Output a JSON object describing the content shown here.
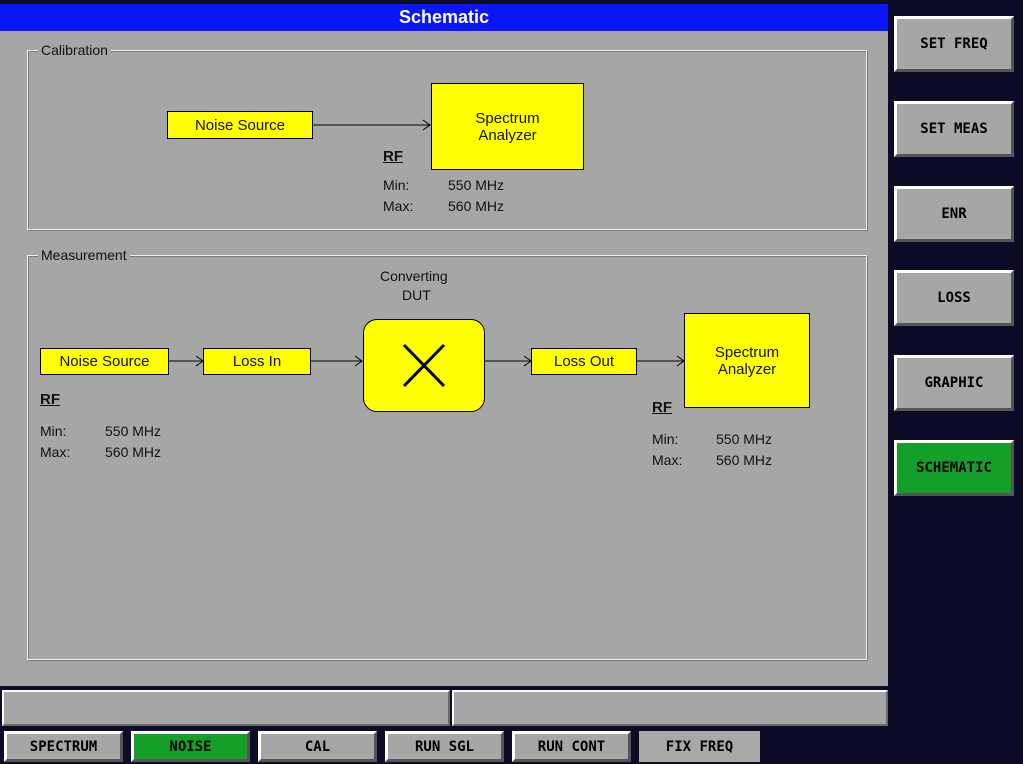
{
  "title": "Schematic",
  "calibration": {
    "label": "Calibration",
    "noise_source": "Noise Source",
    "analyzer": [
      "Spectrum",
      "Analyzer"
    ],
    "rf": "RF",
    "min_label": "Min:",
    "min_value": "550 MHz",
    "max_label": "Max:",
    "max_value": "560 MHz"
  },
  "measurement": {
    "label": "Measurement",
    "noise_source": "Noise Source",
    "loss_in": "Loss In",
    "dut_label": [
      "Converting",
      "DUT"
    ],
    "loss_out": "Loss Out",
    "analyzer": [
      "Spectrum",
      "Analyzer"
    ],
    "rf_left": {
      "title": "RF",
      "min_label": "Min:",
      "min_value": "550 MHz",
      "max_label": "Max:",
      "max_value": "560 MHz"
    },
    "rf_right": {
      "title": "RF",
      "min_label": "Min:",
      "min_value": "550 MHz",
      "max_label": "Max:",
      "max_value": "560 MHz"
    }
  },
  "softkeys": [
    "SET FREQ",
    "SET MEAS",
    "ENR",
    "LOSS",
    "GRAPHIC",
    "SCHEMATIC"
  ],
  "active_softkey": "SCHEMATIC",
  "hotkeys": [
    "SPECTRUM",
    "NOISE",
    "CAL",
    "RUN SGL",
    "RUN CONT",
    "FIX FREQ"
  ],
  "active_hotkey": "NOISE",
  "colors": {
    "title_bar": "#0b16f8",
    "component": "#ffff00",
    "active_key": "#14a028",
    "panel": "#a6a6a6"
  }
}
